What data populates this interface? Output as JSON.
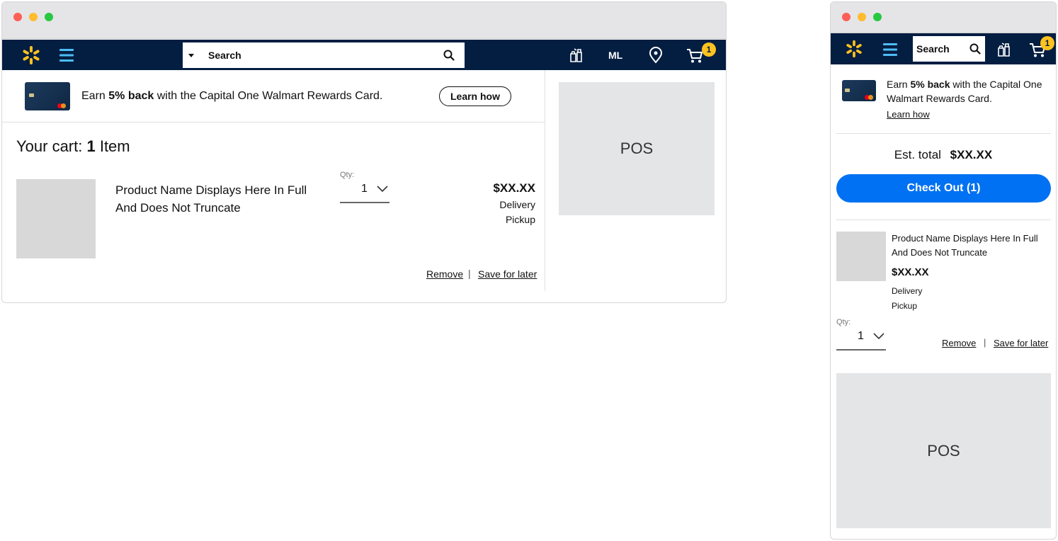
{
  "desktop": {
    "search": {
      "placeholder": "Search"
    },
    "nav": {
      "initials": "ML",
      "cart_count": "1"
    },
    "promo": {
      "prefix": "Earn ",
      "highlight": "5% back",
      "suffix": " with the Capital One Walmart Rewards Card.",
      "cta": "Learn how"
    },
    "cart": {
      "heading_prefix": "Your cart: ",
      "count": "1",
      "heading_suffix": " Item",
      "item": {
        "name_line1": "Product Name Displays Here In Full",
        "name_line2": "And Does Not Truncate",
        "qty_label": "Qty:",
        "qty": "1",
        "price": "$XX.XX",
        "fulfillment": [
          "Delivery",
          "Pickup"
        ],
        "remove": "Remove",
        "separator": "|",
        "save_later": "Save for later"
      }
    },
    "ad": {
      "label": "POS"
    }
  },
  "mobile": {
    "search": {
      "placeholder": "Search"
    },
    "nav": {
      "cart_count": "1"
    },
    "promo": {
      "prefix": "Earn ",
      "highlight": "5% back",
      "suffix": " with the Capital One",
      "line2": "Walmart Rewards Card.",
      "cta": "Learn how"
    },
    "summary": {
      "label": "Est. total",
      "total": "$XX.XX",
      "checkout": "Check Out (1)"
    },
    "item": {
      "name_line1": "Product Name Displays Here In Full",
      "name_line2": "And Does Not Truncate",
      "price": "$XX.XX",
      "fulfillment": [
        "Delivery",
        "Pickup"
      ],
      "qty_label": "Qty:",
      "qty": "1",
      "remove": "Remove",
      "separator": "|",
      "save_later": "Save for later"
    },
    "ad": {
      "label": "POS"
    }
  },
  "colors": {
    "nav": "#041e42",
    "accent": "#ffc220",
    "primary": "#0071f2",
    "menu": "#4dbdf5"
  },
  "icons": [
    "spark-logo-icon",
    "hamburger-menu-icon",
    "search-icon",
    "reorder-icon",
    "location-pin-icon",
    "cart-icon",
    "dropdown-caret-icon",
    "chevron-down-icon"
  ]
}
